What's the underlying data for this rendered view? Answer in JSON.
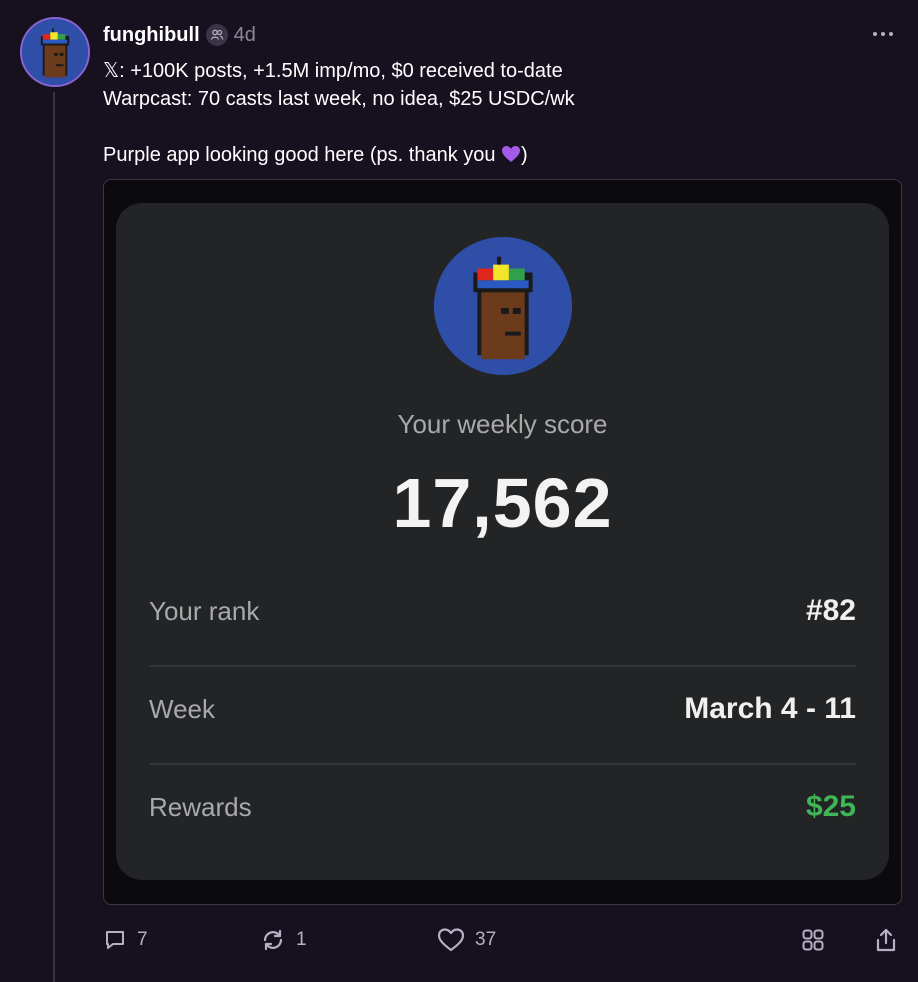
{
  "post": {
    "username": "funghibull",
    "timestamp": "4d",
    "lines": [
      "𝕏: +100K posts, +1.5M imp/mo, $0 received to-date",
      "Warpcast: 70 casts last week, no idea, $25 USDC/wk"
    ],
    "closing_line": "Purple app looking good here (ps. thank you ",
    "closing_end": ")"
  },
  "embed_card": {
    "score_label": "Your weekly score",
    "score_value": "17,562",
    "rows": [
      {
        "label": "Your rank",
        "value": "#82"
      },
      {
        "label": "Week",
        "value": "March 4 - 11"
      },
      {
        "label": "Rewards",
        "value": "$25"
      }
    ],
    "rewards_color": "#3fb556"
  },
  "actions": {
    "replies": "7",
    "recasts": "1",
    "likes": "37"
  },
  "icons": [
    "follow-icon",
    "more-icon",
    "purple-heart-emoji",
    "reply-icon",
    "recast-icon",
    "like-icon",
    "grid-icon",
    "share-icon"
  ],
  "colors": {
    "background": "#17101f",
    "accent": "#8a63d2",
    "card": "#232425"
  }
}
